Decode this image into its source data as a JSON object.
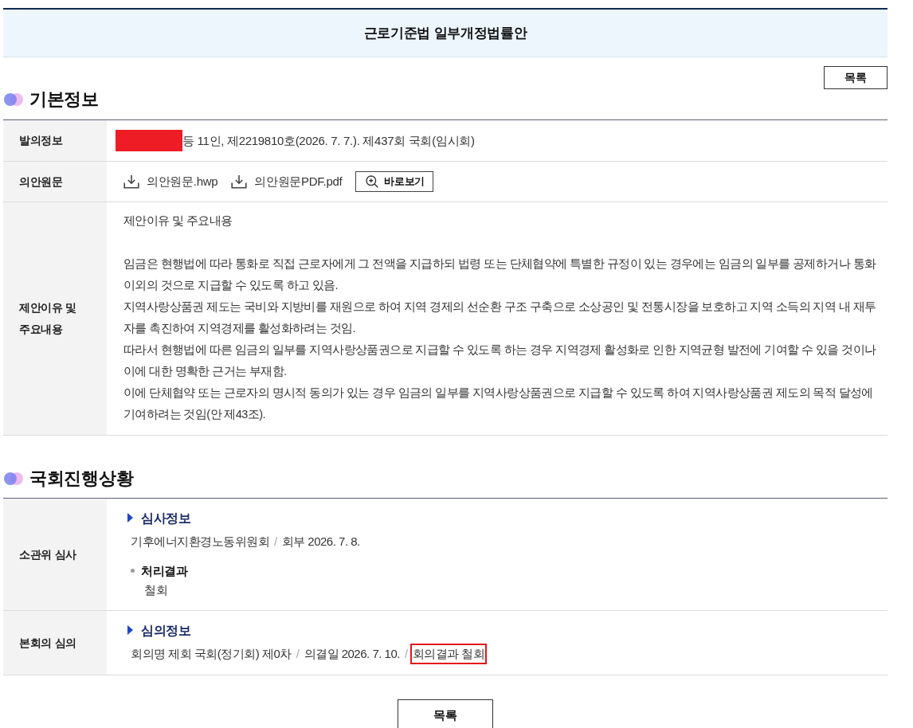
{
  "title_bar": {
    "title": "근로기준법 일부개정법률안"
  },
  "top_actions": {
    "list_button": "목록"
  },
  "basic_info": {
    "heading": "기본정보",
    "rows": [
      {
        "kind": "proposer",
        "label": "발의정보",
        "redacted": true,
        "text": "등 11인, 제2219810호(2026. 7. 7.). 제437회 국회(임시회)"
      },
      {
        "kind": "files",
        "label": "의안원문",
        "files": [
          {
            "name": "의안원문.hwp"
          },
          {
            "name": "의안원문PDF.pdf"
          }
        ],
        "view_button": "바로보기"
      },
      {
        "kind": "body",
        "label": "제안이유 및 주요내용",
        "intro": "제안이유 및 주요내용",
        "paragraphs": [
          "임금은 현행법에 따라 통화로 직접 근로자에게 그 전액을 지급하되 법령 또는 단체협약에 특별한 규정이 있는 경우에는 임금의 일부를 공제하거나 통화 이외의 것으로 지급할 수 있도록 하고 있음.",
          "지역사랑상품권 제도는 국비와 지방비를 재원으로 하여 지역 경제의 선순환 구조 구축으로 소상공인 및 전통시장을 보호하고 지역 소득의 지역 내 재투자를 촉진하여 지역경제를 활성화하려는 것임.",
          "따라서 현행법에 따른 임금의 일부를 지역사랑상품권으로 지급할 수 있도록 하는 경우 지역경제 활성화로 인한 지역균형 발전에 기여할 수 있을 것이나 이에 대한 명확한 근거는 부재함.",
          "이에 단체협약 또는 근로자의 명시적 동의가 있는 경우 임금의 일부를 지역사랑상품권으로 지급할 수 있도록 하여 지역사랑상품권 제도의 목적 달성에 기여하려는 것임(안 제43조)."
        ]
      }
    ]
  },
  "progress": {
    "heading": "국회진행상황",
    "rows": [
      {
        "label": "소관위 심사",
        "subheading": "심사정보",
        "details": [
          {
            "text": "기후에너지환경노동위원회",
            "highlighted": false
          },
          {
            "separator": "/",
            "text": "회부 2026. 7. 8.",
            "highlighted": false
          }
        ],
        "result": {
          "title": "처리결과",
          "value": "철회"
        }
      },
      {
        "label": "본회의 심의",
        "subheading": "심의정보",
        "details": [
          {
            "text": "회의명 제회 국회(정기회) 제0차",
            "highlighted": false
          },
          {
            "separator": "/",
            "text": "의결일 2026. 7. 10.",
            "highlighted": false
          },
          {
            "separator": "/",
            "text": "회의결과 철회",
            "highlighted": true
          }
        ]
      }
    ]
  },
  "bottom_actions": {
    "list_button": "목록"
  }
}
